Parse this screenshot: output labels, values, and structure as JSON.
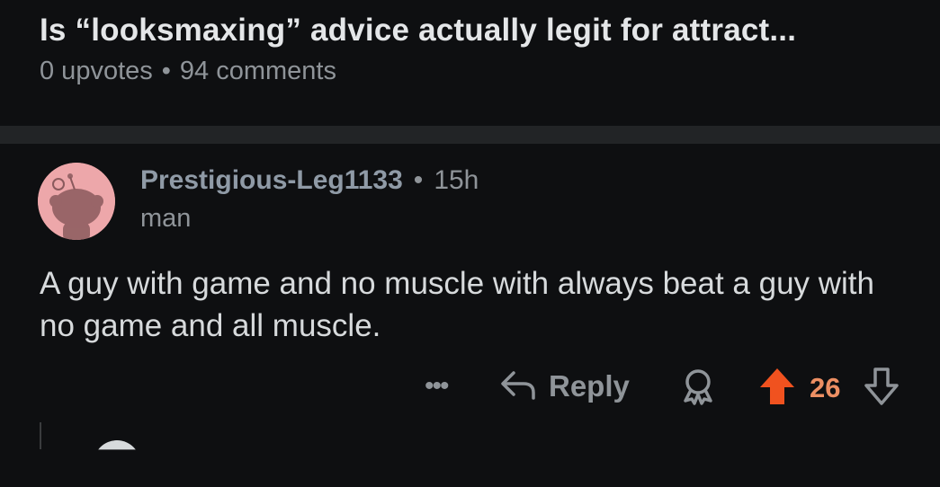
{
  "post": {
    "title": "Is “looksmaxing” advice actually legit for attract...",
    "upvotes": "0 upvotes",
    "separator": "•",
    "comments": "94 comments"
  },
  "comment": {
    "author": "Prestigious-Leg1133",
    "separator": "•",
    "time": "15h",
    "flair": "man",
    "body": "A guy with game and no muscle with always beat a guy with no game and all muscle.",
    "actions": {
      "more_label": "•••",
      "reply_label": "Reply",
      "score": "26"
    }
  },
  "colors": {
    "background": "#0e0f11",
    "divider": "#222426",
    "avatar_bg": "#eda7aa",
    "upvote_active": "#f0521f",
    "score": "#ed8f63",
    "muted": "#8f9499"
  },
  "icons": {
    "avatar": "snoo-avatar-icon",
    "more": "more-options-icon",
    "reply": "reply-arrow-icon",
    "award": "award-icon",
    "upvote": "upvote-arrow-icon",
    "downvote": "downvote-arrow-icon"
  }
}
